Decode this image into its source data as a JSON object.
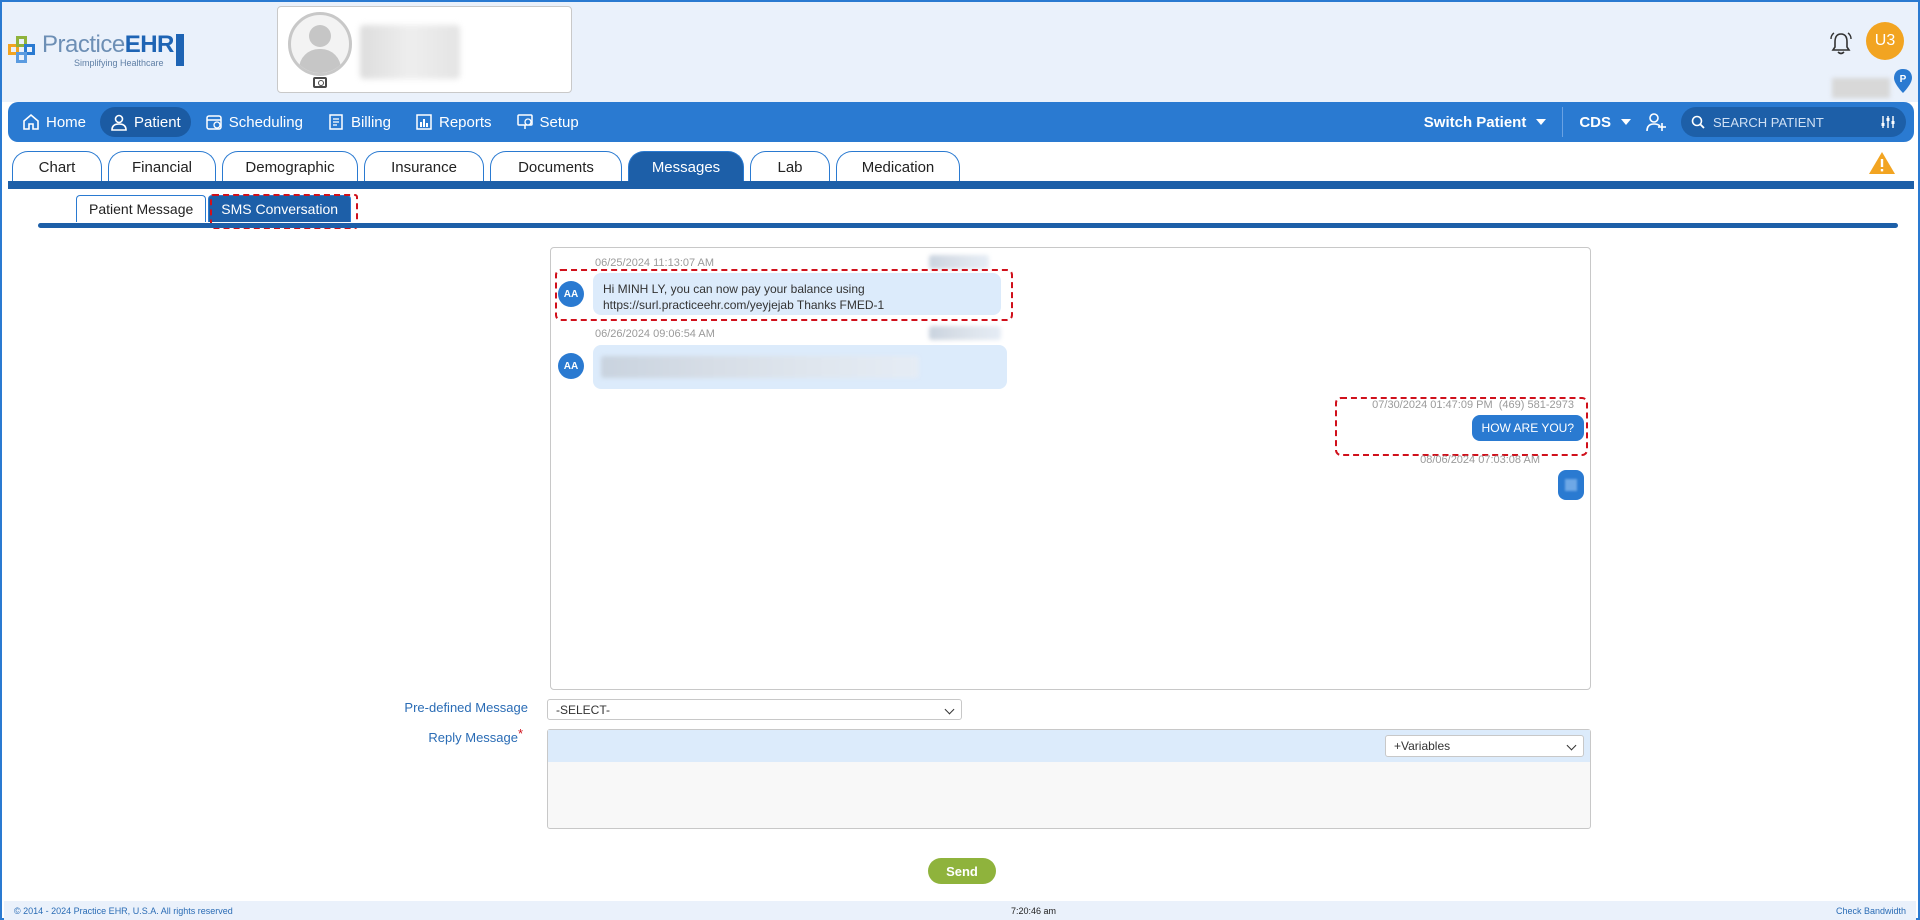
{
  "header": {
    "logo_title_a": "Practice",
    "logo_title_b": "EHR",
    "logo_subtitle": "Simplifying Healthcare",
    "user_initials": "U3"
  },
  "nav": {
    "items": [
      {
        "label": "Home",
        "icon": "home-icon"
      },
      {
        "label": "Patient",
        "icon": "user-icon",
        "active": true
      },
      {
        "label": "Scheduling",
        "icon": "calendar-icon"
      },
      {
        "label": "Billing",
        "icon": "billing-icon"
      },
      {
        "label": "Reports",
        "icon": "reports-icon"
      },
      {
        "label": "Setup",
        "icon": "setup-icon"
      }
    ],
    "switch_patient": "Switch Patient",
    "cds": "CDS",
    "search_placeholder": "SEARCH PATIENT"
  },
  "tabs": [
    "Chart",
    "Financial",
    "Demographic",
    "Insurance",
    "Documents",
    "Messages",
    "Lab",
    "Medication"
  ],
  "active_tab": "Messages",
  "subtabs": [
    "Patient Message",
    "SMS Conversation"
  ],
  "active_subtab": "SMS Conversation",
  "conversation": {
    "messages": [
      {
        "direction": "in",
        "timestamp": "06/25/2024 11:13:07 AM",
        "avatar": "AA",
        "text_line1": "Hi MINH LY, you can now pay your balance using",
        "text_line2": "https://surl.practiceehr.com/yeyjejab Thanks FMED-1"
      },
      {
        "direction": "in",
        "timestamp": "06/26/2024 09:06:54 AM",
        "avatar": "AA",
        "text": ""
      },
      {
        "direction": "out",
        "timestamp": "07/30/2024 01:47:09 PM",
        "phone": "(469) 581-2973",
        "text": "HOW ARE YOU?"
      },
      {
        "direction": "out",
        "timestamp": "08/06/2024 07:03:08 AM",
        "text": ""
      }
    ]
  },
  "form": {
    "predefined_label": "Pre-defined Message",
    "predefined_value": "-SELECT-",
    "reply_label": "Reply Message",
    "required_mark": "*",
    "variables_value": "+Variables",
    "send_label": "Send"
  },
  "footer": {
    "copyright": "© 2014 - 2024 Practice EHR, U.S.A. All rights reserved",
    "time": "7:20:46 am",
    "check_bandwidth": "Check Bandwidth"
  },
  "colors": {
    "primary": "#2a7ad1",
    "primary_dark": "#1d5fa8",
    "accent_orange": "#f2a421",
    "send_green": "#8fb33c",
    "highlight_red": "#d0101b"
  }
}
